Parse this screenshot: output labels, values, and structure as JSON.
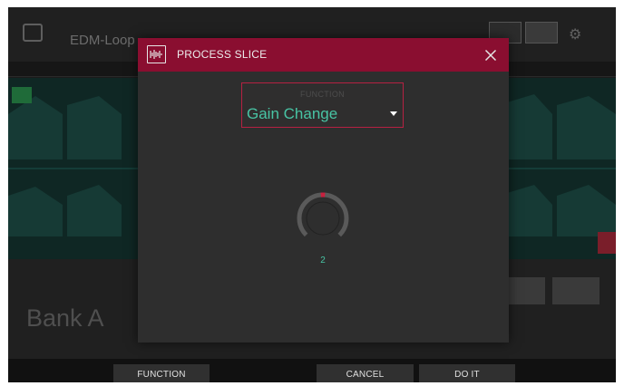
{
  "background": {
    "track_title": "EDM-Loop",
    "bank_label": "Bank A"
  },
  "dialog": {
    "title": "PROCESS SLICE",
    "function": {
      "label": "FUNCTION",
      "value": "Gain Change"
    },
    "knob": {
      "value": "2",
      "level": 0.5
    }
  },
  "function_bar": {
    "function_label": "FUNCTION",
    "cancel_label": "CANCEL",
    "do_it_label": "DO IT"
  },
  "colors": {
    "header": "#8a0e30",
    "accent_red": "#b62142",
    "value_teal": "#48c4a4",
    "dialog_bg": "#2e2e2e"
  },
  "icons": {
    "header": "waveform-slice-icon",
    "close": "close-icon",
    "dropdown": "caret-down-icon"
  }
}
